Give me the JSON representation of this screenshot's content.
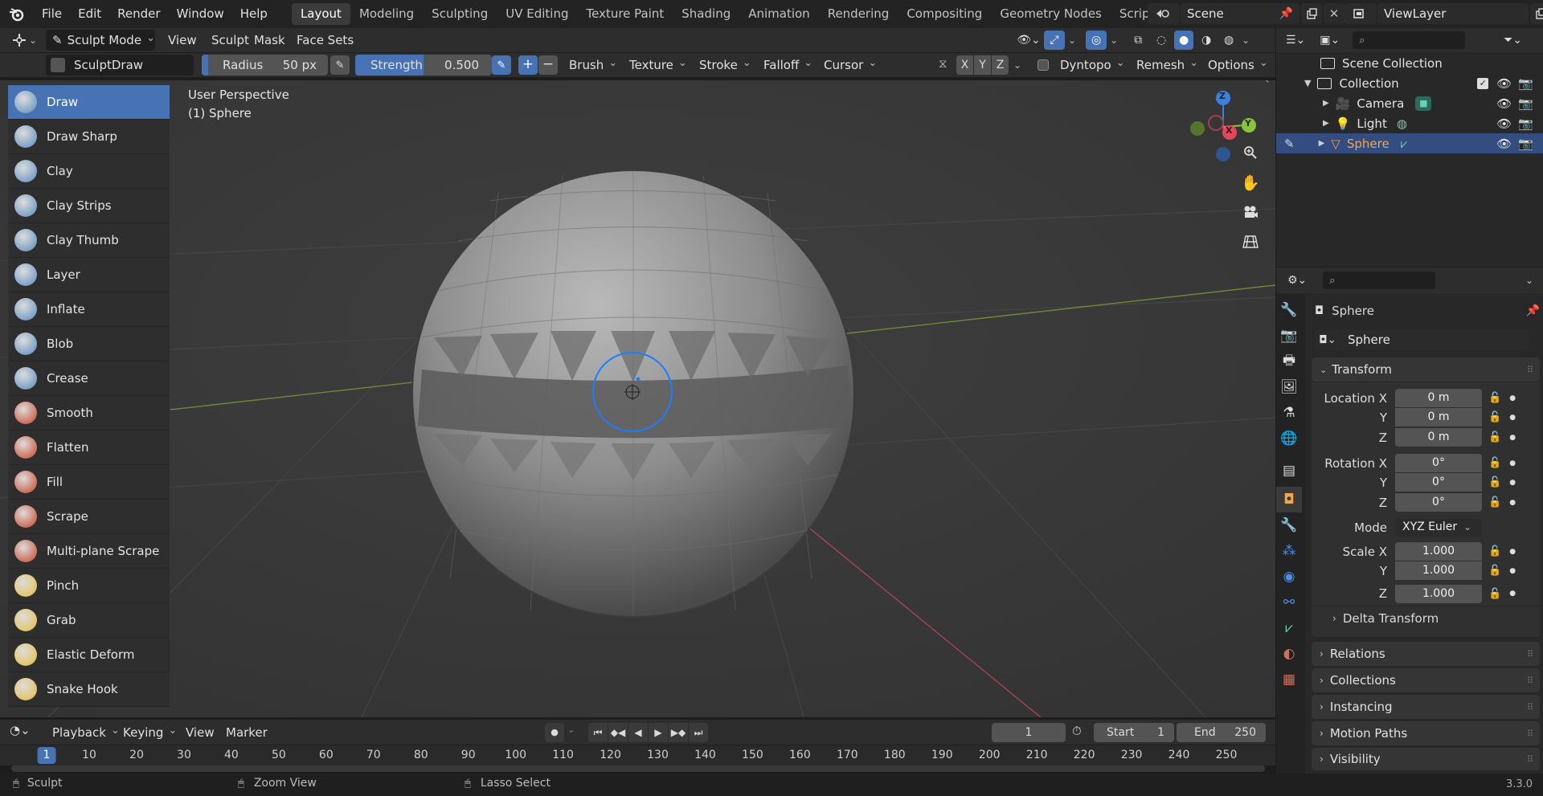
{
  "menu": {
    "file": "File",
    "edit": "Edit",
    "render": "Render",
    "window": "Window",
    "help": "Help"
  },
  "workspaces": [
    "Layout",
    "Modeling",
    "Sculpting",
    "UV Editing",
    "Texture Paint",
    "Shading",
    "Animation",
    "Rendering",
    "Compositing",
    "Geometry Nodes",
    "Scripting"
  ],
  "add_workspace": "+",
  "scene": {
    "name": "Scene",
    "view_layer": "ViewLayer"
  },
  "header": {
    "mode": "Sculpt Mode",
    "view": "View",
    "sculpt": "Sculpt",
    "mask": "Mask",
    "face_sets": "Face Sets"
  },
  "tool_settings": {
    "brush_name": "SculptDraw",
    "radius_label": "Radius",
    "radius_value": "50 px",
    "strength_label": "Strength",
    "strength_value": "0.500",
    "plus": "+",
    "minus": "−",
    "brush": "Brush",
    "texture": "Texture",
    "stroke": "Stroke",
    "falloff": "Falloff",
    "cursor": "Cursor",
    "axis_x": "X",
    "axis_y": "Y",
    "axis_z": "Z",
    "dyntopo": "Dyntopo",
    "remesh": "Remesh",
    "options": "Options"
  },
  "brushes": [
    {
      "label": "Draw",
      "color": "#7fa3c8"
    },
    {
      "label": "Draw Sharp",
      "color": "#7fa3c8"
    },
    {
      "label": "Clay",
      "color": "#7fa3c8"
    },
    {
      "label": "Clay Strips",
      "color": "#7fa3c8"
    },
    {
      "label": "Clay Thumb",
      "color": "#7fa3c8"
    },
    {
      "label": "Layer",
      "color": "#7fa3c8"
    },
    {
      "label": "Inflate",
      "color": "#7fa3c8"
    },
    {
      "label": "Blob",
      "color": "#7fa3c8"
    },
    {
      "label": "Crease",
      "color": "#7fa3c8"
    },
    {
      "label": "Smooth",
      "color": "#d06f5b"
    },
    {
      "label": "Flatten",
      "color": "#d06f5b"
    },
    {
      "label": "Fill",
      "color": "#d06f5b"
    },
    {
      "label": "Scrape",
      "color": "#d06f5b"
    },
    {
      "label": "Multi-plane Scrape",
      "color": "#d06f5b"
    },
    {
      "label": "Pinch",
      "color": "#e3c76c"
    },
    {
      "label": "Grab",
      "color": "#e3c76c"
    },
    {
      "label": "Elastic Deform",
      "color": "#e3c76c"
    },
    {
      "label": "Snake Hook",
      "color": "#e3c76c"
    }
  ],
  "viewport": {
    "perspective": "User Perspective",
    "object": "(1) Sphere",
    "gizmo_x": "X",
    "gizmo_y": "Y",
    "gizmo_z": "Z"
  },
  "outliner": {
    "scene_collection": "Scene Collection",
    "collection": "Collection",
    "items": [
      "Camera",
      "Light",
      "Sphere"
    ]
  },
  "properties": {
    "object_name": "Sphere",
    "data_name": "Sphere",
    "transform": "Transform",
    "location_label": "Location X",
    "loc_x": "0 m",
    "loc_y": "0 m",
    "loc_z": "0 m",
    "rotation_label": "Rotation X",
    "rot_x": "0°",
    "rot_y": "0°",
    "rot_z": "0°",
    "mode_label": "Mode",
    "mode_value": "XYZ Euler",
    "scale_label": "Scale X",
    "scale_x": "1.000",
    "scale_y": "1.000",
    "scale_z": "1.000",
    "y": "Y",
    "z": "Z",
    "delta_transform": "Delta Transform",
    "sections": [
      "Relations",
      "Collections",
      "Instancing",
      "Motion Paths",
      "Visibility"
    ]
  },
  "timeline": {
    "playback": "Playback",
    "keying": "Keying",
    "view": "View",
    "marker": "Marker",
    "current_frame": "1",
    "start_label": "Start",
    "start": "1",
    "end_label": "End",
    "end": "250",
    "ticks": [
      "1",
      "10",
      "20",
      "30",
      "40",
      "50",
      "60",
      "70",
      "80",
      "90",
      "100",
      "110",
      "120",
      "130",
      "140",
      "150",
      "160",
      "170",
      "180",
      "190",
      "200",
      "210",
      "220",
      "230",
      "240",
      "250"
    ]
  },
  "statusbar": {
    "sculpt": "Sculpt",
    "zoom_view": "Zoom View",
    "lasso_select": "Lasso Select",
    "version": "3.3.0"
  },
  "colors": {
    "accent": "#4772b3",
    "selected_row": "#334d80",
    "sphere_name": "#f3a64b",
    "x_axis": "#e2475c",
    "y_axis": "#8ac43f",
    "z_axis": "#3f7fdc"
  }
}
